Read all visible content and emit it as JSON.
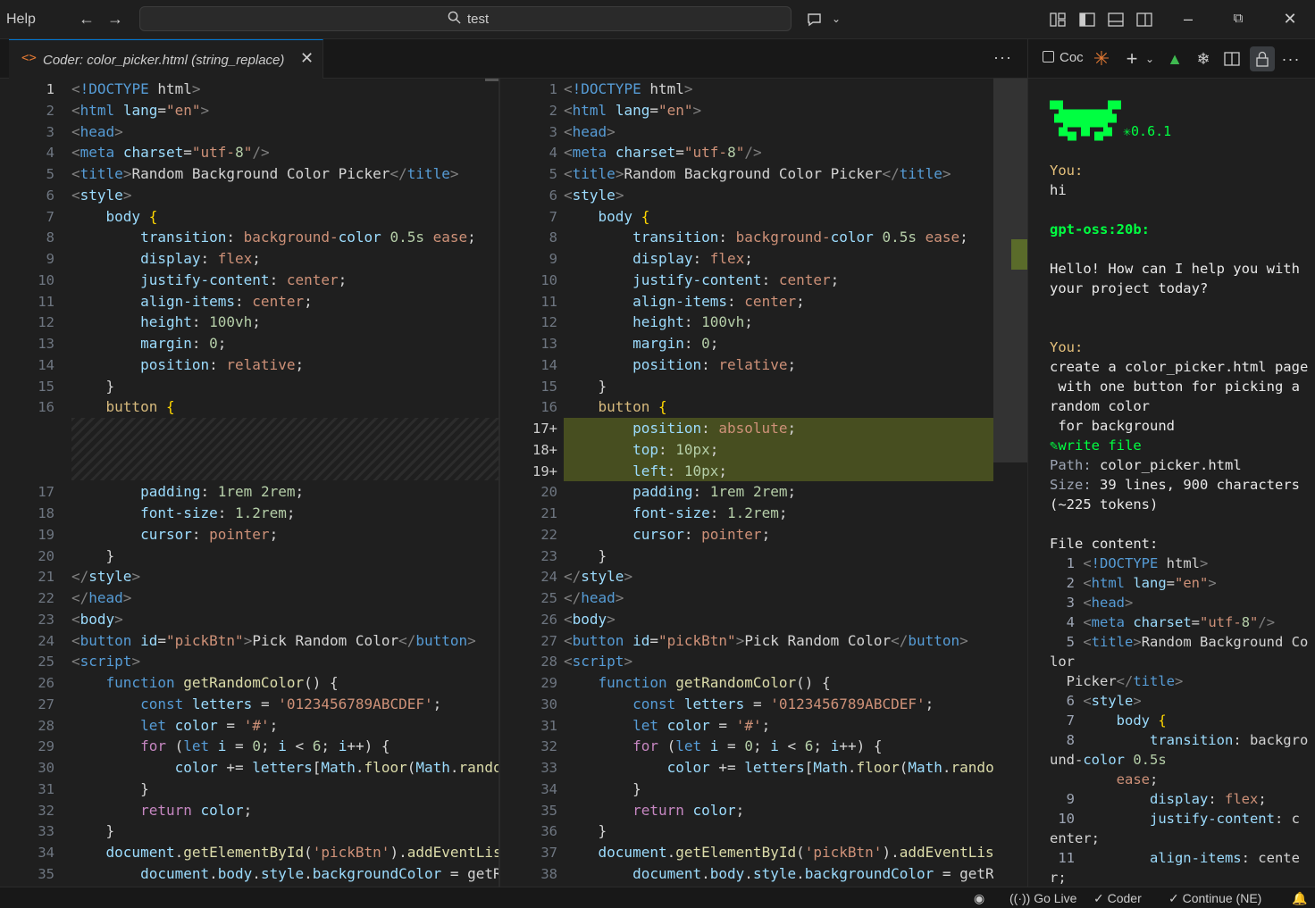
{
  "titlebar": {
    "menu": "Help",
    "search": "test"
  },
  "tab": {
    "label": "Coder: color_picker.html (string_replace)",
    "more": "···"
  },
  "left_pane": {
    "line_numbers": [
      "1",
      "2",
      "3",
      "4",
      "5",
      "6",
      "7",
      "8",
      "9",
      "10",
      "11",
      "12",
      "13",
      "14",
      "15",
      "16",
      "17",
      "18",
      "19",
      "20",
      "21",
      "22",
      "23",
      "24",
      "25",
      "26",
      "27",
      "28",
      "29",
      "30",
      "31",
      "32",
      "33",
      "34",
      "35"
    ]
  },
  "right_pane": {
    "line_numbers": [
      "1",
      "2",
      "3",
      "4",
      "5",
      "6",
      "7",
      "8",
      "9",
      "10",
      "11",
      "12",
      "13",
      "14",
      "15",
      "16",
      "17+",
      "18+",
      "19+",
      "20",
      "21",
      "22",
      "23",
      "24",
      "25",
      "26",
      "27",
      "28",
      "29",
      "30",
      "31",
      "32",
      "33",
      "34",
      "35",
      "36",
      "37",
      "38"
    ]
  },
  "code_lines": [
    "<!DOCTYPE html>",
    "<html lang=\"en\">",
    "<head>",
    "<meta charset=\"utf-8\"/>",
    "<title>Random Background Color Picker</title>",
    "<style>",
    "    body {",
    "        transition: background-color 0.5s ease;",
    "        display: flex;",
    "        justify-content: center;",
    "        align-items: center;",
    "        height: 100vh;",
    "        margin: 0;",
    "        position: relative;",
    "    }",
    "    button {",
    "        position: absolute;",
    "        top: 10px;",
    "        left: 10px;",
    "        padding: 1rem 2rem;",
    "        font-size: 1.2rem;",
    "        cursor: pointer;",
    "    }",
    "</style>",
    "</head>",
    "<body>",
    "<button id=\"pickBtn\">Pick Random Color</button>",
    "<script>",
    "    function getRandomColor() {",
    "        const letters = '0123456789ABCDEF';",
    "        let color = '#';",
    "        for (let i = 0; i < 6; i++) {",
    "            color += letters[Math.floor(Math.rando",
    "        }",
    "        return color;",
    "    }",
    "    document.getElementById('pickBtn').addEventLis",
    "        document.body.style.backgroundColor = getR"
  ],
  "chat": {
    "tab_label": "Coc",
    "version": "0.6.1",
    "you_label_1": "You:",
    "msg_1": "hi",
    "model_label": "gpt-oss:20b:",
    "reply_1": "Hello! How can I help you with",
    "reply_2": "your project today?",
    "you_label_2": "You:",
    "msg_2a": "create a color_picker.html page",
    "msg_2b": " with one button for picking a",
    "msg_2c": "random color",
    "msg_2d": " for background",
    "tool": "write file",
    "path_label": "Path:",
    "path_value": "color_picker.html",
    "size_label": "Size:",
    "size_value": "39 lines, 900 characters",
    "tokens": "(~225 tokens)",
    "file_content_label": "File content:"
  },
  "status": {
    "go_live": "Go Live",
    "coder": "Coder",
    "continue": "Continue (NE)"
  },
  "colors": {
    "accent": "#0078d4",
    "added_line": "#4b5320",
    "chat_green": "#00ff41"
  }
}
